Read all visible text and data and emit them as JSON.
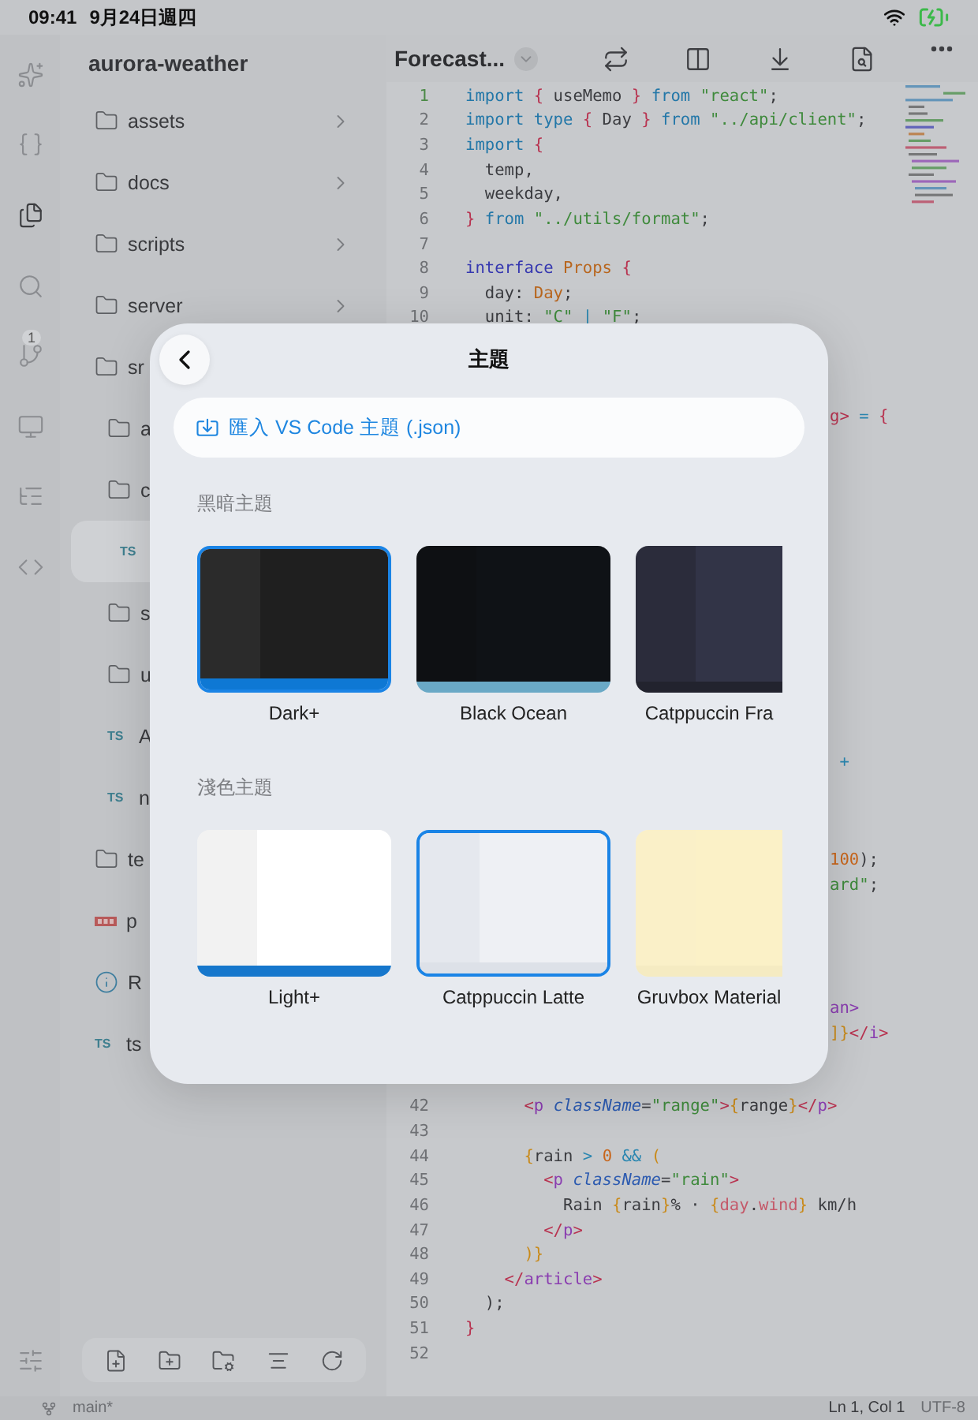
{
  "status_bar": {
    "time": "09:41",
    "date": "9月24日週四"
  },
  "activity_bar": {
    "items": [
      {
        "kind": "sparkle",
        "selected": false
      },
      {
        "kind": "braces",
        "selected": false
      },
      {
        "kind": "files",
        "selected": true
      },
      {
        "kind": "search",
        "selected": false
      },
      {
        "kind": "branch",
        "selected": false,
        "badge": "1"
      },
      {
        "kind": "monitor",
        "selected": false
      },
      {
        "kind": "outline",
        "selected": false
      },
      {
        "kind": "code",
        "selected": false
      }
    ]
  },
  "sidebar": {
    "title": "aurora-weather",
    "items": [
      {
        "name": "assets",
        "kind": "folder",
        "chevron": true,
        "selected": false
      },
      {
        "name": "docs",
        "kind": "folder",
        "chevron": true,
        "selected": false
      },
      {
        "name": "scripts",
        "kind": "folder",
        "chevron": true,
        "selected": false
      },
      {
        "name": "server",
        "kind": "folder",
        "chevron": true,
        "selected": false
      },
      {
        "name": "sr",
        "kind": "folder",
        "selected": false,
        "children": [
          {
            "name": "a",
            "kind": "folder",
            "selected": false
          },
          {
            "name": "c",
            "kind": "folder",
            "selected": false,
            "children": [
              {
                "kind": "ts",
                "icon_text": "TS",
                "selected": true
              }
            ]
          },
          {
            "name": "s",
            "kind": "folder",
            "selected": false
          },
          {
            "name": "u",
            "kind": "folder",
            "selected": false
          },
          {
            "name": "A",
            "kind": "ts",
            "icon_text": "TS",
            "selected": false
          },
          {
            "name": "n",
            "kind": "ts",
            "icon_text": "TS",
            "selected": false
          }
        ]
      },
      {
        "name": "te",
        "kind": "folder",
        "selected": false
      },
      {
        "name": "p",
        "kind": "npm",
        "selected": false
      },
      {
        "name": "R",
        "kind": "info",
        "selected": false
      },
      {
        "name": "ts",
        "kind": "ts",
        "icon_text": "TS",
        "selected": false
      }
    ]
  },
  "editor": {
    "title": "Forecast...",
    "lines": [
      {
        "kind": "code",
        "number": "1",
        "current": true,
        "tokens": [
          {
            "text": "import ",
            "kind": "keyword"
          },
          {
            "text": "{",
            "kind": "brace"
          },
          {
            "text": " useMemo ",
            "kind": "plain"
          },
          {
            "text": "} ",
            "kind": "brace"
          },
          {
            "text": "from ",
            "kind": "keyword"
          },
          {
            "text": "\"react\"",
            "kind": "string"
          },
          {
            "text": ";",
            "kind": "plain"
          }
        ]
      },
      {
        "kind": "code",
        "number": "2",
        "current": false,
        "tokens": [
          {
            "text": "import type ",
            "kind": "keyword"
          },
          {
            "text": "{",
            "kind": "brace"
          },
          {
            "text": " Day ",
            "kind": "plain"
          },
          {
            "text": "} ",
            "kind": "brace"
          },
          {
            "text": "from ",
            "kind": "keyword"
          },
          {
            "text": "\"../api/client\"",
            "kind": "string"
          },
          {
            "text": ";",
            "kind": "plain"
          }
        ]
      },
      {
        "kind": "code",
        "number": "3",
        "current": false,
        "tokens": [
          {
            "text": "import ",
            "kind": "keyword"
          },
          {
            "text": "{",
            "kind": "brace"
          }
        ]
      },
      {
        "kind": "code",
        "number": "4",
        "current": false,
        "tokens": [
          {
            "text": "  temp,",
            "kind": "plain"
          }
        ]
      },
      {
        "kind": "code",
        "number": "5",
        "current": false,
        "tokens": [
          {
            "text": "  weekday,",
            "kind": "plain"
          }
        ]
      },
      {
        "kind": "code",
        "number": "6",
        "current": false,
        "tokens": [
          {
            "text": "} ",
            "kind": "brace"
          },
          {
            "text": "from ",
            "kind": "keyword"
          },
          {
            "text": "\"../utils/format\"",
            "kind": "string"
          },
          {
            "text": ";",
            "kind": "plain"
          }
        ]
      },
      {
        "kind": "code",
        "number": "7",
        "current": false
      },
      {
        "kind": "code",
        "number": "8",
        "current": false,
        "tokens": [
          {
            "text": "interface ",
            "kind": "declare"
          },
          {
            "text": "Props ",
            "kind": "type"
          },
          {
            "text": "{",
            "kind": "brace"
          }
        ]
      },
      {
        "kind": "code",
        "number": "9",
        "current": false,
        "tokens": [
          {
            "text": "  day: ",
            "kind": "plain"
          },
          {
            "text": "Day",
            "kind": "type"
          },
          {
            "text": ";",
            "kind": "plain"
          }
        ]
      },
      {
        "kind": "code",
        "number": "10",
        "current": false,
        "tokens": [
          {
            "text": "  unit: ",
            "kind": "plain"
          },
          {
            "text": "\"C\"",
            "kind": "string"
          },
          {
            "text": " | ",
            "kind": "op"
          },
          {
            "text": "\"F\"",
            "kind": "string"
          },
          {
            "text": ";",
            "kind": "plain"
          }
        ]
      },
      {
        "kind": "hidden"
      },
      {
        "kind": "hidden"
      },
      {
        "kind": "hidden"
      },
      {
        "kind": "fragment",
        "tokens": [
          {
            "text": "g> ",
            "kind": "brace"
          },
          {
            "text": "= ",
            "kind": "op"
          },
          {
            "text": "{",
            "kind": "brace"
          }
        ]
      },
      {
        "kind": "hidden"
      },
      {
        "kind": "hidden"
      },
      {
        "kind": "hidden"
      },
      {
        "kind": "hidden"
      },
      {
        "kind": "hidden"
      },
      {
        "kind": "hidden"
      },
      {
        "kind": "hidden"
      },
      {
        "kind": "hidden"
      },
      {
        "kind": "hidden"
      },
      {
        "kind": "hidden"
      },
      {
        "kind": "hidden"
      },
      {
        "kind": "hidden"
      },
      {
        "kind": "hidden"
      },
      {
        "kind": "fragment",
        "tokens": [
          {
            "text": " +",
            "kind": "op"
          }
        ]
      },
      {
        "kind": "hidden"
      },
      {
        "kind": "hidden"
      },
      {
        "kind": "hidden"
      },
      {
        "kind": "fragment",
        "tokens": [
          {
            "text": "100",
            "kind": "number"
          },
          {
            "text": ");",
            "kind": "plain"
          }
        ]
      },
      {
        "kind": "fragment",
        "tokens": [
          {
            "text": "ard\"",
            "kind": "string"
          },
          {
            "text": ";",
            "kind": "plain"
          }
        ]
      },
      {
        "kind": "hidden"
      },
      {
        "kind": "hidden"
      },
      {
        "kind": "hidden"
      },
      {
        "kind": "hidden"
      },
      {
        "kind": "fragment",
        "tokens": [
          {
            "text": "an>",
            "kind": "tag"
          }
        ]
      },
      {
        "kind": "fragment",
        "tokens": [
          {
            "text": "]}",
            "kind": "bracket"
          },
          {
            "text": "</",
            "kind": "brace"
          },
          {
            "text": "i",
            "kind": "tag"
          },
          {
            "text": ">",
            "kind": "brace"
          }
        ]
      },
      {
        "kind": "hidden"
      },
      {
        "kind": "hidden"
      },
      {
        "kind": "code",
        "number": "42",
        "current": false,
        "tokens": [
          {
            "text": "      <",
            "kind": "brace"
          },
          {
            "text": "p ",
            "kind": "tag"
          },
          {
            "text": "className",
            "kind": "attr"
          },
          {
            "text": "=",
            "kind": "plain"
          },
          {
            "text": "\"range\"",
            "kind": "string"
          },
          {
            "text": ">",
            "kind": "brace"
          },
          {
            "text": "{",
            "kind": "bracket"
          },
          {
            "text": "range",
            "kind": "plain"
          },
          {
            "text": "}",
            "kind": "bracket"
          },
          {
            "text": "</",
            "kind": "brace"
          },
          {
            "text": "p",
            "kind": "tag"
          },
          {
            "text": ">",
            "kind": "brace"
          }
        ]
      },
      {
        "kind": "code",
        "number": "43",
        "current": false
      },
      {
        "kind": "code",
        "number": "44",
        "current": false,
        "tokens": [
          {
            "text": "      {",
            "kind": "bracket"
          },
          {
            "text": "rain ",
            "kind": "plain"
          },
          {
            "text": "> ",
            "kind": "op"
          },
          {
            "text": "0 ",
            "kind": "number"
          },
          {
            "text": "&& ",
            "kind": "op"
          },
          {
            "text": "(",
            "kind": "bracket"
          }
        ]
      },
      {
        "kind": "code",
        "number": "45",
        "current": false,
        "tokens": [
          {
            "text": "        <",
            "kind": "brace"
          },
          {
            "text": "p ",
            "kind": "tag"
          },
          {
            "text": "className",
            "kind": "attr"
          },
          {
            "text": "=",
            "kind": "plain"
          },
          {
            "text": "\"rain\"",
            "kind": "string"
          },
          {
            "text": ">",
            "kind": "brace"
          }
        ]
      },
      {
        "kind": "code",
        "number": "46",
        "current": false,
        "tokens": [
          {
            "text": "          Rain ",
            "kind": "plain"
          },
          {
            "text": "{",
            "kind": "bracket"
          },
          {
            "text": "rain",
            "kind": "plain"
          },
          {
            "text": "}",
            "kind": "bracket"
          },
          {
            "text": "% · ",
            "kind": "plain"
          },
          {
            "text": "{",
            "kind": "bracket"
          },
          {
            "text": "day",
            "kind": "member"
          },
          {
            "text": ".",
            "kind": "plain"
          },
          {
            "text": "wind",
            "kind": "member"
          },
          {
            "text": "} ",
            "kind": "bracket"
          },
          {
            "text": "km/h",
            "kind": "plain"
          }
        ]
      },
      {
        "kind": "code",
        "number": "47",
        "current": false,
        "tokens": [
          {
            "text": "        </",
            "kind": "brace"
          },
          {
            "text": "p",
            "kind": "tag"
          },
          {
            "text": ">",
            "kind": "brace"
          }
        ]
      },
      {
        "kind": "code",
        "number": "48",
        "current": false,
        "tokens": [
          {
            "text": "      )}",
            "kind": "bracket"
          }
        ]
      },
      {
        "kind": "code",
        "number": "49",
        "current": false,
        "tokens": [
          {
            "text": "    </",
            "kind": "brace"
          },
          {
            "text": "article",
            "kind": "tag"
          },
          {
            "text": ">",
            "kind": "brace"
          }
        ]
      },
      {
        "kind": "code",
        "number": "50",
        "current": false,
        "tokens": [
          {
            "text": "  );",
            "kind": "plain"
          }
        ]
      },
      {
        "kind": "code",
        "number": "51",
        "current": false,
        "tokens": [
          {
            "text": "}",
            "kind": "brace"
          }
        ]
      },
      {
        "kind": "code",
        "number": "52",
        "current": false
      }
    ]
  },
  "editor_status": {
    "branch": "main*",
    "position": "Ln 1, Col 1",
    "encoding": "UTF-8"
  },
  "theme_dialog": {
    "title": "主題",
    "import_label": "匯入 VS Code 主題 (.json)",
    "sections": [
      {
        "heading": "黑暗主題",
        "themes": [
          {
            "name": "Dark+",
            "selected": true,
            "parts": [
              {
                "kind": "sidebar",
                "color": "#2b2b2b"
              },
              {
                "kind": "editor",
                "color": "#1f1f1f"
              },
              {
                "kind": "bar",
                "color": "#0e78d4"
              }
            ]
          },
          {
            "name": "Black Ocean",
            "selected": false,
            "parts": [
              {
                "kind": "sidebar",
                "color": "#0e1013"
              },
              {
                "kind": "editor",
                "color": "#0f1216"
              },
              {
                "kind": "bar",
                "color": "#6aa9c6"
              }
            ]
          },
          {
            "name": "Catppuccin Fra",
            "selected": false,
            "parts": [
              {
                "kind": "sidebar",
                "color": "#2b2c3b"
              },
              {
                "kind": "editor",
                "color": "#323447"
              },
              {
                "kind": "bar",
                "color": "#22232e"
              }
            ]
          }
        ]
      },
      {
        "heading": "淺色主題",
        "themes": [
          {
            "name": "Light+",
            "selected": false,
            "parts": [
              {
                "kind": "sidebar",
                "color": "#f2f2f2"
              },
              {
                "kind": "editor",
                "color": "#ffffff"
              },
              {
                "kind": "bar",
                "color": "#1677cc"
              }
            ]
          },
          {
            "name": "Catppuccin Latte",
            "selected": true,
            "parts": [
              {
                "kind": "sidebar",
                "color": "#e5e8ee"
              },
              {
                "kind": "editor",
                "color": "#eef0f4"
              },
              {
                "kind": "bar",
                "color": "#dde1e8"
              }
            ]
          },
          {
            "name": "Gruvbox Material",
            "selected": false,
            "parts": [
              {
                "kind": "sidebar",
                "color": "#faf0c8"
              },
              {
                "kind": "editor",
                "color": "#fbf1c7"
              },
              {
                "kind": "bar",
                "color": "#f5ebc2"
              }
            ]
          }
        ]
      }
    ]
  }
}
